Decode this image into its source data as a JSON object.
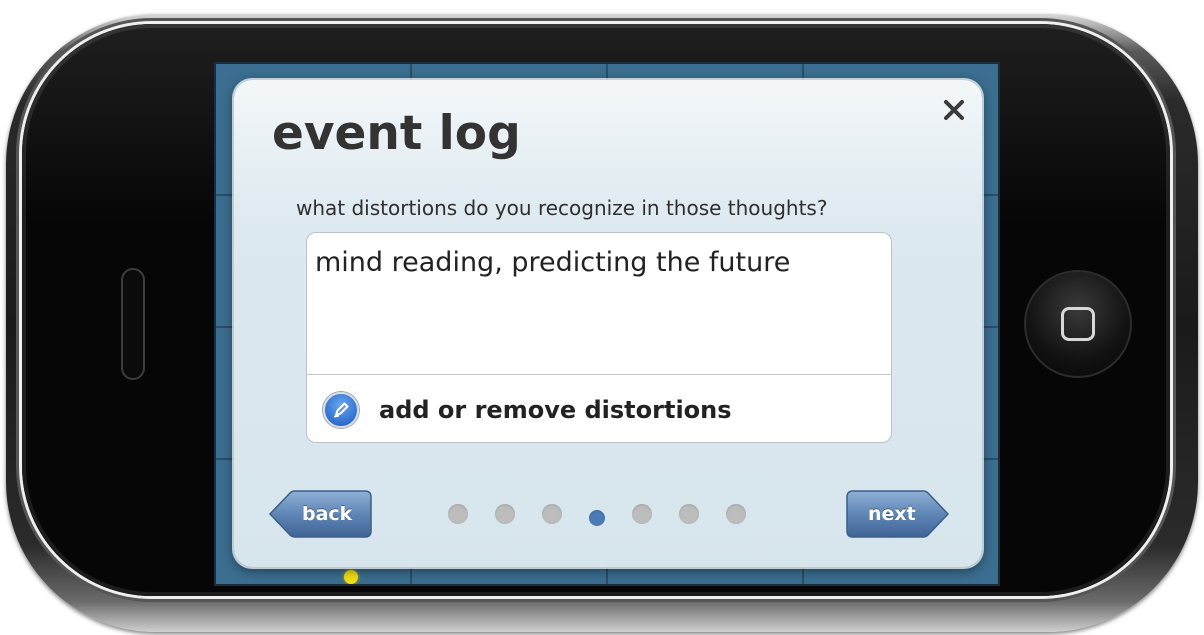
{
  "dialog": {
    "title": "event log",
    "question": "what distortions do you recognize in those thoughts?",
    "answer": "mind reading, predicting the future",
    "edit_action_label": "add or remove distortions",
    "close_icon": "close-icon",
    "edit_icon": "pencil-icon"
  },
  "navigation": {
    "back_label": "back",
    "next_label": "next",
    "page_count": 7,
    "current_page": 4
  },
  "colors": {
    "screen_background": "#3b6e90",
    "dialog_background": "#dde9f0",
    "nav_button": "#5f86b5",
    "active_dot": "#4b7bb7",
    "inactive_dot": "#bcbcbc",
    "marker": "#f3df17"
  }
}
